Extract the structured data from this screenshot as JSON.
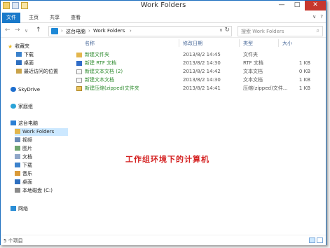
{
  "window": {
    "title": "Work Folders",
    "minimize": "—",
    "maximize": "□",
    "close": "✕"
  },
  "ribbon": {
    "tabs": [
      "文件",
      "主页",
      "共享",
      "查看"
    ],
    "expand": "∨",
    "help": "?"
  },
  "address": {
    "back": "←",
    "forward": "→",
    "recent": "∨",
    "up": "↑",
    "breadcrumbs": [
      "这台电脑",
      "Work Folders"
    ],
    "separator": "›",
    "dropdown": "∨",
    "refresh": "↻",
    "search_placeholder": "搜索 Work Folders",
    "search_icon": "⌕"
  },
  "sidebar": {
    "items": [
      {
        "label": "收藏夹",
        "icon": "star-icon"
      },
      {
        "label": "下载",
        "icon": "downloads-icon"
      },
      {
        "label": "桌面",
        "icon": "desktop-icon"
      },
      {
        "label": "最近访问的位置",
        "icon": "recent-places-icon"
      },
      {
        "label": "SkyDrive",
        "icon": "skydrive-icon"
      },
      {
        "label": "家庭组",
        "icon": "homegroup-icon"
      },
      {
        "label": "这台电脑",
        "icon": "this-pc-icon"
      },
      {
        "label": "Work Folders",
        "icon": "work-folders-icon"
      },
      {
        "label": "视频",
        "icon": "videos-icon"
      },
      {
        "label": "图片",
        "icon": "pictures-icon"
      },
      {
        "label": "文档",
        "icon": "documents-icon"
      },
      {
        "label": "下载",
        "icon": "downloads-icon"
      },
      {
        "label": "音乐",
        "icon": "music-icon"
      },
      {
        "label": "桌面",
        "icon": "desktop-icon"
      },
      {
        "label": "本地磁盘 (C:)",
        "icon": "local-disk-icon"
      },
      {
        "label": "网络",
        "icon": "network-icon"
      }
    ]
  },
  "columns": {
    "name": "名称",
    "date": "修改日期",
    "type": "类型",
    "size": "大小"
  },
  "files": [
    {
      "name": "新建文件夹",
      "date": "2013/8/2 14:45",
      "type": "文件夹",
      "size": "",
      "icon": "folder-icon"
    },
    {
      "name": "新建 RTF 文档",
      "date": "2013/8/2 14:30",
      "type": "RTF 文档",
      "size": "1 KB",
      "icon": "rtf-document-icon"
    },
    {
      "name": "新建文本文档 (2)",
      "date": "2013/8/2 14:42",
      "type": "文本文档",
      "size": "0 KB",
      "icon": "text-document-icon"
    },
    {
      "name": "新建文本文档",
      "date": "2013/8/2 14:30",
      "type": "文本文档",
      "size": "1 KB",
      "icon": "text-document-icon"
    },
    {
      "name": "新建压缩(zipped)文件夹",
      "date": "2013/8/2 14:41",
      "type": "压缩(zipped)文件...",
      "size": "1 KB",
      "icon": "zip-folder-icon"
    }
  ],
  "annotation": "工作组环境下的计算机",
  "status": {
    "count": "5 个项目"
  }
}
